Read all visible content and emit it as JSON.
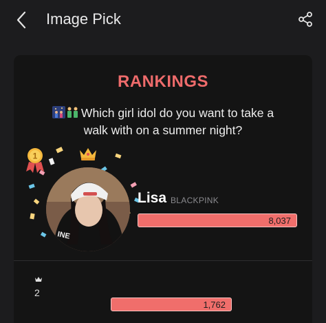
{
  "header": {
    "title": "Image Pick",
    "back_icon": "chevron-left-icon",
    "share_icon": "share-icon"
  },
  "card": {
    "heading": "RANKINGS",
    "question_emoji": "couple-night-emoji",
    "question": "Which girl idol do you want to take a walk with on a summer night?"
  },
  "rankings": [
    {
      "rank": 1,
      "name": "Lisa",
      "group": "BLACKPINK",
      "votes": "8,037",
      "share": 1.0
    },
    {
      "rank": 2,
      "name": "",
      "group": "",
      "votes": "1,762",
      "share": 0.22
    }
  ],
  "colors": {
    "accent": "#ee6b6b",
    "bar": "#f06e6b",
    "background": "#1c1c1e",
    "card": "#141414"
  }
}
